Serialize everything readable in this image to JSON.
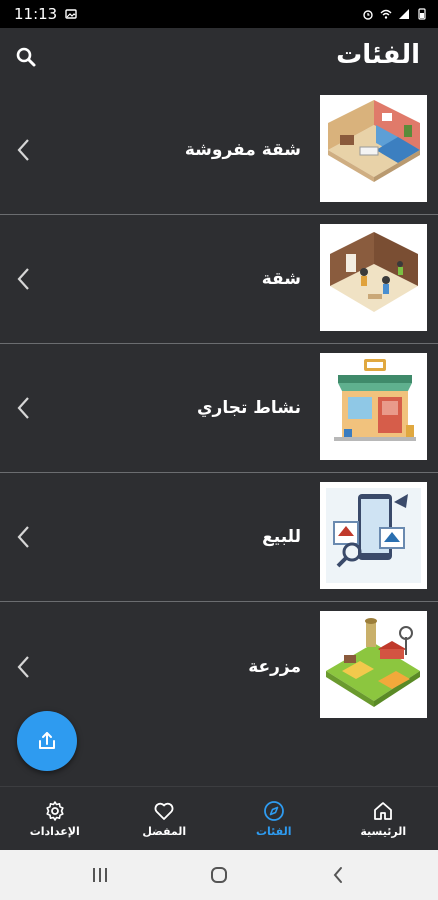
{
  "status_bar": {
    "time": "11:13"
  },
  "app_bar": {
    "title": "الفئات"
  },
  "categories": [
    {
      "label": "شقة مفروشة"
    },
    {
      "label": "شقة"
    },
    {
      "label": "نشاط تجاري"
    },
    {
      "label": "للبيع"
    },
    {
      "label": "مزرعة"
    }
  ],
  "bottom_nav": {
    "home": "الرئيسية",
    "categories": "الفئات",
    "favorites": "المفضل",
    "settings": "الإعدادات"
  },
  "colors": {
    "accent": "#2e9bf0",
    "background": "#2d2e31",
    "divider": "#6b6d70"
  },
  "icons": {
    "search": "search-icon",
    "chevron": "chevron-left-icon",
    "share": "share-icon",
    "home": "home-icon",
    "compass": "compass-icon",
    "heart": "heart-icon",
    "gear": "gear-icon"
  }
}
